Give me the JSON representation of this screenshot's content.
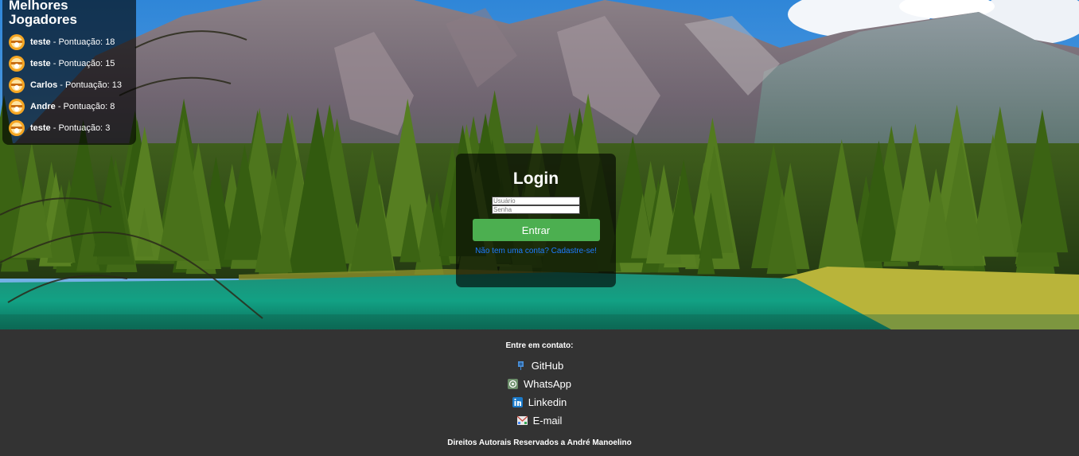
{
  "leaderboard": {
    "title": "Melhores Jogadores",
    "entries": [
      {
        "name": "teste",
        "label": " - Pontuação: ",
        "score": "18"
      },
      {
        "name": "teste",
        "label": " - Pontuação: ",
        "score": "15"
      },
      {
        "name": "Carlos",
        "label": " - Pontuação: ",
        "score": "13"
      },
      {
        "name": "Andre",
        "label": " - Pontuação: ",
        "score": "8"
      },
      {
        "name": "teste",
        "label": " - Pontuação: ",
        "score": "3"
      }
    ]
  },
  "login": {
    "title": "Login",
    "username_placeholder": "Usuário",
    "password_placeholder": "Senha",
    "submit_label": "Entrar",
    "signup_text": "Não tem uma conta? Cadastre-se!"
  },
  "footer": {
    "contact_heading": "Entre em contato:",
    "links": [
      {
        "label": "GitHub",
        "icon": "github-icon"
      },
      {
        "label": "WhatsApp",
        "icon": "whatsapp-icon"
      },
      {
        "label": "Linkedin",
        "icon": "linkedin-icon"
      },
      {
        "label": "E-mail",
        "icon": "email-icon"
      }
    ],
    "copyright": "Direitos Autorais Reservados a André Manoelino"
  },
  "colors": {
    "button_green": "#4caf50",
    "link_blue": "#1e7bff",
    "footer_bg": "#333333"
  }
}
